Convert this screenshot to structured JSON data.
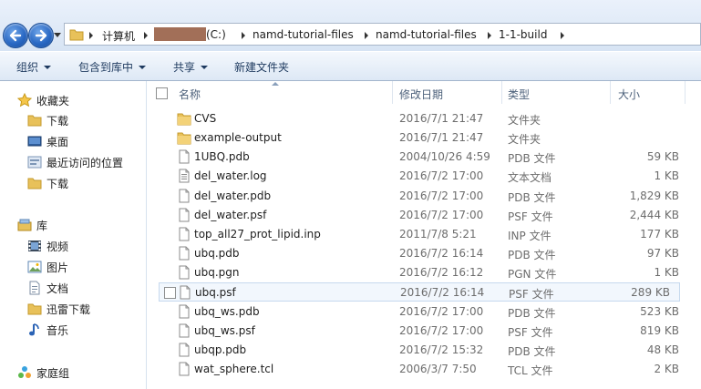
{
  "address": {
    "crumbs": [
      "计算机",
      "(C:)",
      "namd-tutorial-files",
      "namd-tutorial-files",
      "1-1-build"
    ]
  },
  "toolbar": {
    "organize": "组织",
    "include_in_library": "包含到库中",
    "share": "共享",
    "new_folder": "新建文件夹"
  },
  "sidebar": {
    "favorites": {
      "label": "收藏夹",
      "items": [
        "下载",
        "桌面",
        "最近访问的位置",
        "下载"
      ]
    },
    "libraries": {
      "label": "库",
      "items": [
        "视频",
        "图片",
        "文档",
        "迅雷下载",
        "音乐"
      ]
    },
    "homegroup": "家庭组"
  },
  "columns": {
    "name": "名称",
    "date": "修改日期",
    "type": "类型",
    "size": "大小"
  },
  "files": [
    {
      "name": "CVS",
      "date": "2016/7/1 21:47",
      "type": "文件夹",
      "size": "",
      "kind": "folder"
    },
    {
      "name": "example-output",
      "date": "2016/7/1 21:47",
      "type": "文件夹",
      "size": "",
      "kind": "folder"
    },
    {
      "name": "1UBQ.pdb",
      "date": "2004/10/26 4:59",
      "type": "PDB 文件",
      "size": "59 KB",
      "kind": "file"
    },
    {
      "name": "del_water.log",
      "date": "2016/7/2 17:00",
      "type": "文本文档",
      "size": "1 KB",
      "kind": "text"
    },
    {
      "name": "del_water.pdb",
      "date": "2016/7/2 17:00",
      "type": "PDB 文件",
      "size": "1,829 KB",
      "kind": "file"
    },
    {
      "name": "del_water.psf",
      "date": "2016/7/2 17:00",
      "type": "PSF 文件",
      "size": "2,444 KB",
      "kind": "file"
    },
    {
      "name": "top_all27_prot_lipid.inp",
      "date": "2011/7/8 5:21",
      "type": "INP 文件",
      "size": "177 KB",
      "kind": "file"
    },
    {
      "name": "ubq.pdb",
      "date": "2016/7/2 16:14",
      "type": "PDB 文件",
      "size": "97 KB",
      "kind": "file"
    },
    {
      "name": "ubq.pgn",
      "date": "2016/7/2 16:12",
      "type": "PGN 文件",
      "size": "1 KB",
      "kind": "file"
    },
    {
      "name": "ubq.psf",
      "date": "2016/7/2 16:14",
      "type": "PSF 文件",
      "size": "289 KB",
      "kind": "file"
    },
    {
      "name": "ubq_ws.pdb",
      "date": "2016/7/2 17:00",
      "type": "PDB 文件",
      "size": "523 KB",
      "kind": "file"
    },
    {
      "name": "ubq_ws.psf",
      "date": "2016/7/2 17:00",
      "type": "PSF 文件",
      "size": "819 KB",
      "kind": "file"
    },
    {
      "name": "ubqp.pdb",
      "date": "2016/7/2 15:32",
      "type": "PDB 文件",
      "size": "48 KB",
      "kind": "file"
    },
    {
      "name": "wat_sphere.tcl",
      "date": "2006/3/7 7:50",
      "type": "TCL 文件",
      "size": "2 KB",
      "kind": "file"
    }
  ]
}
